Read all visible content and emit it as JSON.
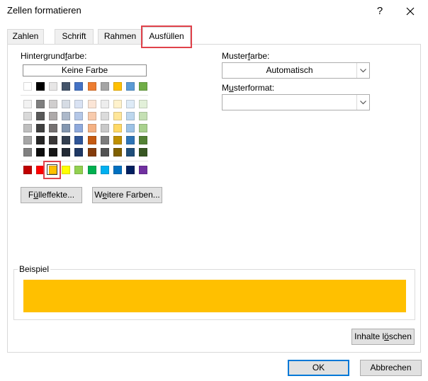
{
  "window": {
    "title": "Zellen formatieren",
    "help_label": "?",
    "close_icon": "close-icon"
  },
  "tabs": [
    {
      "label": "Zahlen",
      "active": false
    },
    {
      "label": "Schrift",
      "active": false
    },
    {
      "label": "Rahmen",
      "active": false
    },
    {
      "label": "Ausfüllen",
      "active": true
    }
  ],
  "background": {
    "label_pre": "Hintergrund",
    "label_u": "f",
    "label_post": "arbe:",
    "no_color_label": "Keine Farbe",
    "selected_color": "#FFC000",
    "highlight_color": "#E0424B"
  },
  "palette": {
    "theme_row": [
      "#FFFFFF",
      "#000000",
      "#E7E6E6",
      "#44546A",
      "#4472C4",
      "#ED7D31",
      "#A5A5A5",
      "#FFC000",
      "#5B9BD5",
      "#70AD47"
    ],
    "shades": [
      [
        "#F2F2F2",
        "#7F7F7F",
        "#D0CECE",
        "#D6DCE4",
        "#D9E2F3",
        "#FBE5D6",
        "#EDEDED",
        "#FFF2CC",
        "#DEEBF7",
        "#E2F0D9"
      ],
      [
        "#D9D9D9",
        "#595959",
        "#AEAAAA",
        "#ADB9CA",
        "#B4C7E7",
        "#F8CBAD",
        "#DBDBDB",
        "#FFE699",
        "#BDD7EE",
        "#C5E0B4"
      ],
      [
        "#BFBFBF",
        "#404040",
        "#757171",
        "#8497B0",
        "#8FAADC",
        "#F4B183",
        "#C9C9C9",
        "#FFD966",
        "#9DC3E6",
        "#A9D18E"
      ],
      [
        "#A6A6A6",
        "#262626",
        "#3A3838",
        "#333F50",
        "#2F5597",
        "#C55A11",
        "#7B7B7B",
        "#BF9000",
        "#2E75B6",
        "#548235"
      ],
      [
        "#808080",
        "#0D0D0D",
        "#171717",
        "#222A35",
        "#1F3864",
        "#843C0C",
        "#525252",
        "#7F6000",
        "#1F4E79",
        "#385723"
      ]
    ],
    "standard_row": [
      "#C00000",
      "#FF0000",
      "#FFC000",
      "#FFFF00",
      "#92D050",
      "#00B050",
      "#00B0F0",
      "#0070C0",
      "#002060",
      "#7030A0"
    ]
  },
  "buttons": {
    "fill_effects_pre": "F",
    "fill_effects_u": "ü",
    "fill_effects_post": "lleffekte...",
    "more_colors_pre": "W",
    "more_colors_u": "e",
    "more_colors_post": "itere Farben...",
    "clear_pre": "Inhalte l",
    "clear_u": "ö",
    "clear_post": "schen",
    "ok": "OK",
    "cancel": "Abbrechen"
  },
  "pattern_color": {
    "label_pre": "Muster",
    "label_u": "f",
    "label_post": "arbe:",
    "value": "Automatisch"
  },
  "pattern_style": {
    "label_pre": "M",
    "label_u": "u",
    "label_post": "sterformat:",
    "value": ""
  },
  "sample": {
    "label": "Beispiel",
    "fill_color": "#FFC000"
  }
}
